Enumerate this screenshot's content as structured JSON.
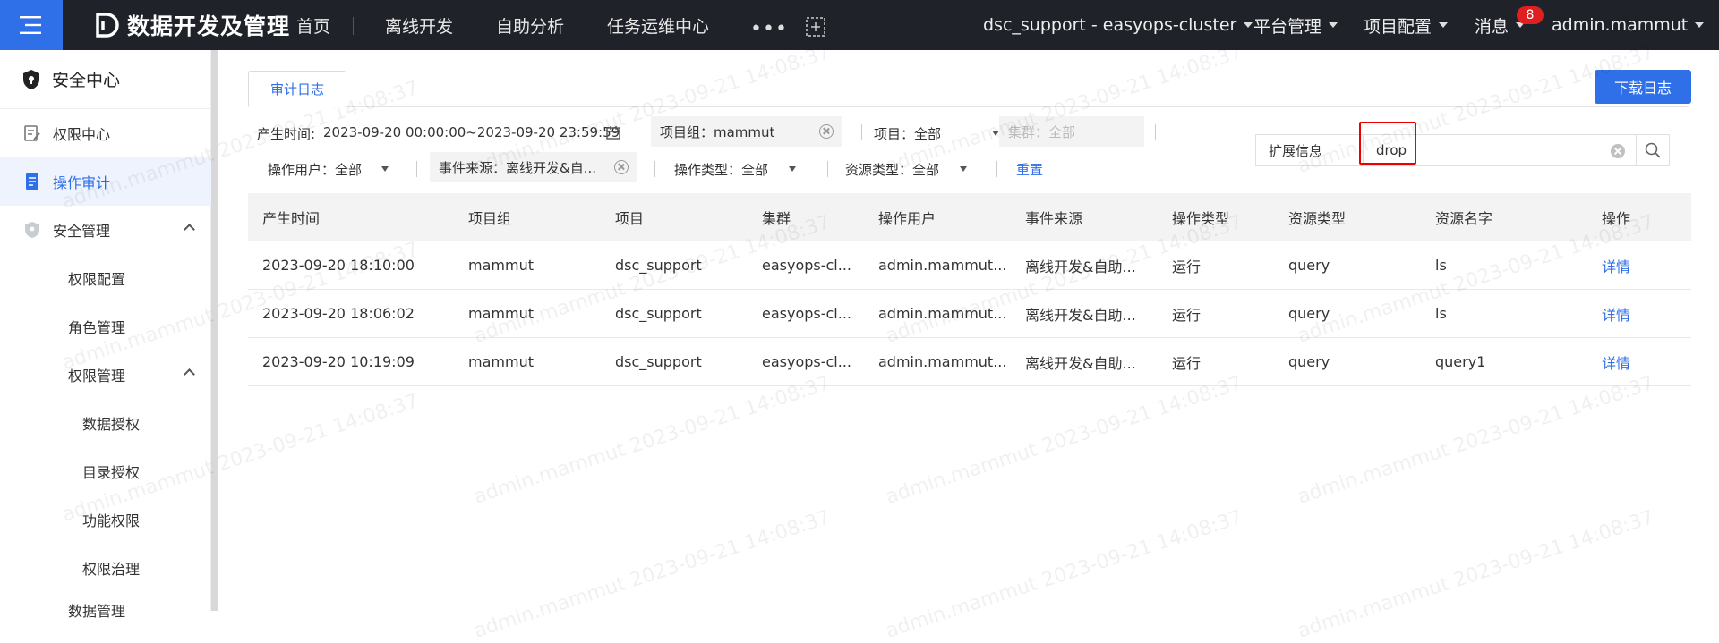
{
  "header": {
    "app_title": "数据开发及管理",
    "nav": [
      "首页",
      "离线开发",
      "自助分析",
      "任务运维中心"
    ],
    "more_label": "•••",
    "workspace": "dsc_support - easyops-cluster",
    "platform_mgmt": "平台管理",
    "project_config": "项目配置",
    "messages": "消息",
    "message_count": "8",
    "user": "admin.mammut"
  },
  "sidebar": {
    "title": "安全中心",
    "items": [
      {
        "label": "权限中心"
      },
      {
        "label": "操作审计"
      },
      {
        "label": "安全管理"
      }
    ],
    "sub_items": [
      "权限配置",
      "角色管理",
      "权限管理"
    ],
    "sub_sub_items": [
      "数据授权",
      "目录授权",
      "功能权限",
      "权限治理"
    ],
    "partial_item": "数据管理"
  },
  "main": {
    "tab_label": "审计日志",
    "download_label": "下载日志",
    "filters": {
      "time_label": "产生时间:",
      "time_value": "2023-09-20 00:00:00~2023-09-20 23:59:59",
      "project_group": "项目组：mammut",
      "project": "项目：全部",
      "cluster": "集群：全部",
      "op_user": "操作用户：全部",
      "event_source": "事件来源：离线开发&自...",
      "op_type": "操作类型：全部",
      "resource_type": "资源类型：全部",
      "reset": "重置"
    },
    "search": {
      "ext_label": "扩展信息",
      "value": "drop"
    },
    "table": {
      "headers": [
        "产生时间",
        "项目组",
        "项目",
        "集群",
        "操作用户",
        "事件来源",
        "操作类型",
        "资源类型",
        "资源名字",
        "操作"
      ],
      "rows": [
        [
          "2023-09-20 18:10:00",
          "mammut",
          "dsc_support",
          "easyops-cl...",
          "admin.mammut...",
          "离线开发&自助...",
          "运行",
          "query",
          "ls",
          "详情"
        ],
        [
          "2023-09-20 18:06:02",
          "mammut",
          "dsc_support",
          "easyops-cl...",
          "admin.mammut...",
          "离线开发&自助...",
          "运行",
          "query",
          "ls",
          "详情"
        ],
        [
          "2023-09-20 10:19:09",
          "mammut",
          "dsc_support",
          "easyops-cl...",
          "admin.mammut...",
          "离线开发&自助...",
          "运行",
          "query",
          "query1",
          "详情"
        ]
      ]
    }
  },
  "watermark": "admin.mammut 2023-09-21 14:08:37",
  "colors": {
    "accent": "#2f6fe8",
    "topbar": "#1f2229",
    "badge": "#e02020",
    "highlight": "#e00000"
  }
}
